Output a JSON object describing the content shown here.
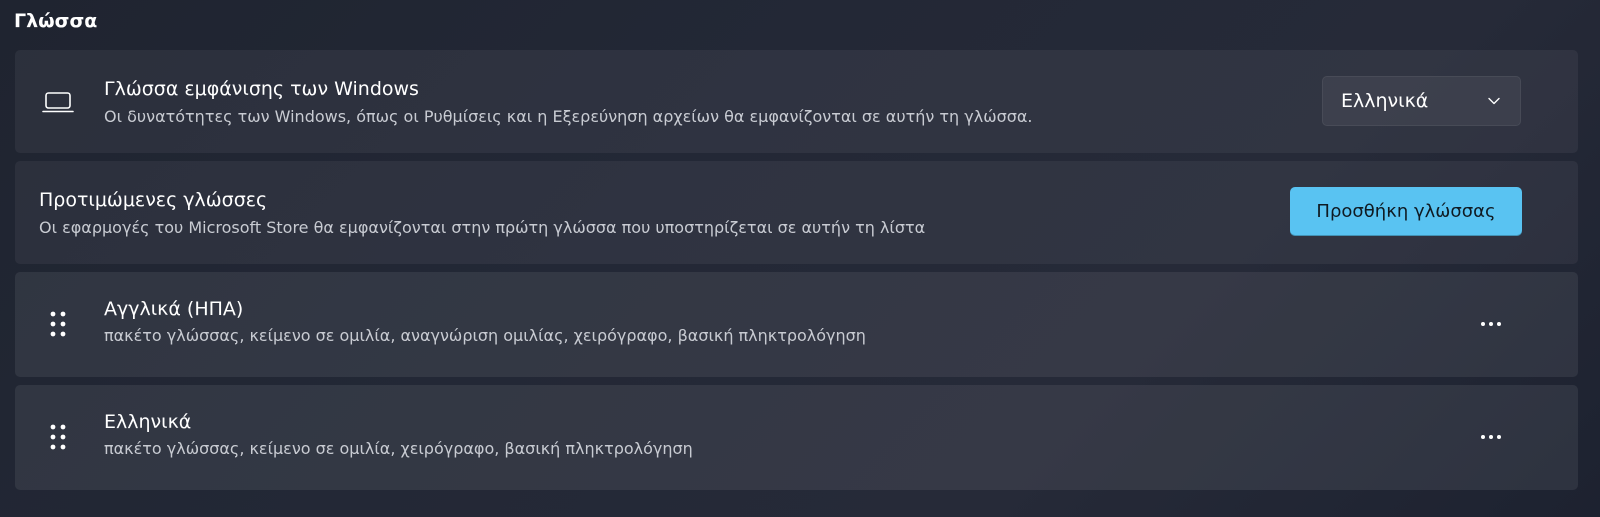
{
  "section": {
    "title": "Γλώσσα"
  },
  "display_language": {
    "icon": "laptop-icon",
    "title": "Γλώσσα εμφάνισης των Windows",
    "description": "Οι δυνατότητες των Windows, όπως οι Ρυθμίσεις και η Εξερεύνηση αρχείων θα εμφανίζονται σε αυτήν τη γλώσσα.",
    "selected_value": "Ελληνικά"
  },
  "preferred_languages": {
    "title": "Προτιμώμενες γλώσσες",
    "description": "Οι εφαρμογές του Microsoft Store θα εμφανίζονται στην πρώτη γλώσσα που υποστηρίζεται σε αυτήν τη λίστα",
    "add_button_label": "Προσθήκη γλώσσας",
    "accent_color": "#59c3f2"
  },
  "languages": [
    {
      "name": "Αγγλικά (ΗΠΑ)",
      "features": "πακέτο γλώσσας, κείμενο σε ομιλία, αναγνώριση ομιλίας, χειρόγραφο, βασική πληκτρολόγηση"
    },
    {
      "name": "Ελληνικά",
      "features": "πακέτο γλώσσας, κείμενο σε ομιλία, χειρόγραφο, βασική πληκτρολόγηση"
    }
  ]
}
